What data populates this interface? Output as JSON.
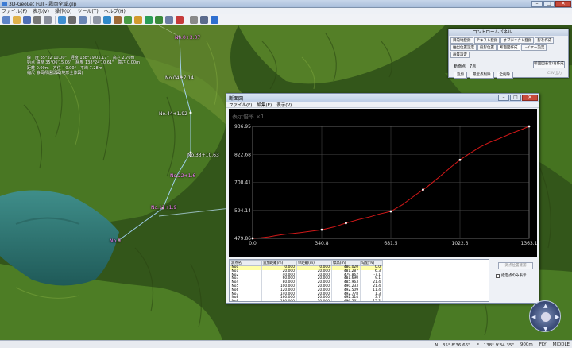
{
  "app": {
    "title": "3D-GeoLet Full - 霧岡全域.glp"
  },
  "window_buttons": {
    "min": "–",
    "max": "□",
    "close": "✕"
  },
  "menu": [
    "ファイル(F)",
    "表示(V)",
    "操作(O)",
    "ツール(T)",
    "ヘルプ(H)"
  ],
  "toolbar_icons": [
    "new-icon",
    "open-icon",
    "save-icon",
    "print-icon",
    "print-preview-icon",
    "rotate-icon",
    "layers-icon",
    "list-icon",
    "cube-icon",
    "globe-icon",
    "camera-icon",
    "image-icon",
    "folder-icon",
    "chart-icon",
    "terrain-icon",
    "grid-icon",
    "flag-icon",
    "measure-icon",
    "tool-icon",
    "help-icon"
  ],
  "info_overlay": [
    "緯　度 35°22'10.00\"　経度 138°19'01.17\"　高さ 2.70m",
    "始点 緯度 35°06'15.05\"　経度 138°24'10.61\"　高さ 0.00m",
    "距離 0.00m　方位 +0.00°　平均 7.28m",
    "縮尺 静岡県遠景図(地形全体図)"
  ],
  "map_labels": [
    {
      "text": "No.0+3.07",
      "selected": true
    },
    {
      "text": "No.04+7.14",
      "selected": false
    },
    {
      "text": "No.44+1.92",
      "selected": false
    },
    {
      "text": "No.33+10.63",
      "selected": false
    },
    {
      "text": "No.22+1.6",
      "selected": true
    },
    {
      "text": "No.11+1.9",
      "selected": true
    },
    {
      "text": "No.0",
      "selected": true
    }
  ],
  "control_panel": {
    "title": "コントロールパネル",
    "tabs": [
      "目的地登録",
      "テキスト登録",
      "オブジェクト登録",
      "影を作成",
      "抽出位置設定",
      "投影位置",
      "断面図作成",
      "レイヤー設定",
      "画質設定"
    ],
    "cross_section_label": "断面点　7点",
    "buttons": [
      "追加",
      "最近点削除",
      "全削除"
    ],
    "right_button": "断面図表示/再作成",
    "right_button2": "CSV出力"
  },
  "dialog": {
    "title": "断面図",
    "menu": [
      "ファイル(F)",
      "編集(E)",
      "表示(V)"
    ],
    "scale_label": "表示倍率 ×1",
    "grid_columns": [
      "測点名",
      "追加距離(m)",
      "単距離(m)",
      "標高(m)",
      "勾配(%)"
    ],
    "rows": [
      [
        "No0",
        "0.000",
        "0.000",
        "480.020",
        "0.0"
      ],
      [
        "No1",
        "20.000",
        "20.000",
        "481.287",
        "6.3"
      ],
      [
        "No2",
        "40.000",
        "20.000",
        "479.862",
        "-7.1"
      ],
      [
        "No3",
        "60.000",
        "20.000",
        "481.690",
        "9.1"
      ],
      [
        "No4",
        "80.000",
        "20.000",
        "485.963",
        "21.4"
      ],
      [
        "No5",
        "100.000",
        "20.000",
        "490.233",
        "21.4"
      ],
      [
        "No6",
        "120.000",
        "20.000",
        "492.509",
        "11.4"
      ],
      [
        "No7",
        "140.000",
        "20.000",
        "492.778",
        "1.3"
      ],
      [
        "No8",
        "160.000",
        "20.000",
        "492.514",
        "3.7"
      ],
      [
        "No9",
        "180.000",
        "20.000",
        "496.561",
        "15.2"
      ],
      [
        "No10",
        "200.000",
        "20.000",
        "499.056",
        "10.0"
      ]
    ],
    "side_button": "測点位置確認",
    "checkbox_label": "指定点のみ表示"
  },
  "chart_data": {
    "type": "line",
    "title": "",
    "xlabel": "",
    "ylabel": "",
    "xlim": [
      0,
      1363.1
    ],
    "ylim": [
      479.86,
      936.95
    ],
    "x_ticks": [
      "0.0",
      "340.8",
      "681.5",
      "1022.3",
      "1363.1"
    ],
    "y_ticks": [
      "936.95",
      "822.68",
      "708.41",
      "594.14",
      "479.86"
    ],
    "series": [
      {
        "color": "#d01818",
        "x": [
          0,
          40,
          80,
          120,
          160,
          200,
          240,
          280,
          340.8,
          400,
          460,
          520,
          580,
          620,
          681.5,
          740,
          800,
          860,
          920,
          980,
          1022.3,
          1070,
          1120,
          1170,
          1220,
          1270,
          1320,
          1363.1
        ],
        "values": [
          480.0,
          482.0,
          486.0,
          492.0,
          497.0,
          500.0,
          504.0,
          508.0,
          515.0,
          526.0,
          542.0,
          556.0,
          568.0,
          578.0,
          590.0,
          618.0,
          655.0,
          690.0,
          730.0,
          772.0,
          800.0,
          826.0,
          852.0,
          872.0,
          888.0,
          906.0,
          922.0,
          936.95
        ]
      }
    ],
    "markers_x": [
      0,
      340.8,
      460,
      681.5,
      840,
      1022.3,
      1363.1
    ],
    "grid": true
  },
  "status": {
    "lat": "N　35° 8'36.66\"",
    "lon": "E　138° 9'34.35\"",
    "height": "900m",
    "mode1": "FLY",
    "mode2": "MIDDLE"
  },
  "nav": {
    "up": "▲",
    "down": "▼",
    "left": "◀",
    "right": "▶"
  }
}
